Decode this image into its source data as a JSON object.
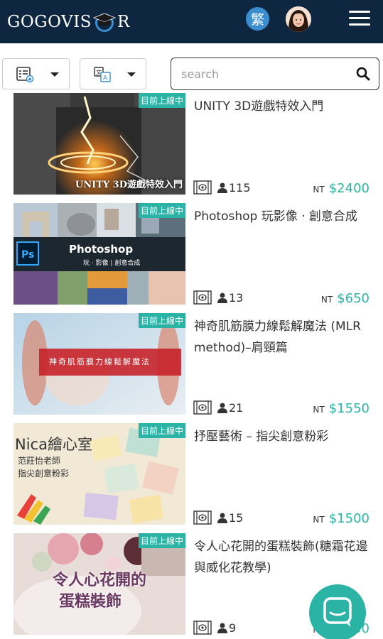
{
  "header": {
    "logo_text_left": "GOGOVIS",
    "logo_text_right": "R",
    "lang_label": "繁",
    "avatar_alt": "user avatar",
    "menu_icon": "hamburger-icon"
  },
  "toolbar": {
    "category_icon": "category-list-icon",
    "language_icon": "translate-icon",
    "search_placeholder": "search",
    "search_icon": "search-icon"
  },
  "courses": [
    {
      "badge": "目前上線中",
      "thumb_caption": "UNITY 3D遊戲特效入門",
      "title": "UNITY 3D遊戲特效入門",
      "students": "115",
      "currency": "NT",
      "price": "$2400"
    },
    {
      "badge": "目前上線中",
      "thumb_caption": "Photoshop",
      "thumb_subcaption": "玩 · 影像 | 創意合成",
      "title": "Photoshop 玩影像 · 創意合成",
      "students": "13",
      "currency": "NT",
      "price": "$650"
    },
    {
      "badge": "目前上線中",
      "thumb_caption": "神奇肌筋膜力線鬆解魔法",
      "title": "神奇肌筋膜力線鬆解魔法 (MLR method)–肩頸篇",
      "students": "21",
      "currency": "NT",
      "price": "$1550"
    },
    {
      "badge": "目前上線中",
      "thumb_caption": "Nica繪心室",
      "thumb_subcaption_1": "范莊怡老師",
      "thumb_subcaption_2": "指尖創意粉彩",
      "title": "抒壓藝術 – 指尖創意粉彩",
      "students": "15",
      "currency": "NT",
      "price": "$1500"
    },
    {
      "badge": "目前上線中",
      "thumb_caption": "令人心花開的",
      "thumb_subcaption": "蛋糕裝飾",
      "title": "令人心花開的蛋糕裝飾(糖霜花邊與威化花教學)",
      "students": "9",
      "currency": "NT",
      "price": "$2000"
    }
  ],
  "colors": {
    "header_bg": "#0f2640",
    "accent": "#2bb3a5",
    "lang_btn": "#3a8ed0"
  },
  "chat": {
    "icon": "chat-icon"
  }
}
